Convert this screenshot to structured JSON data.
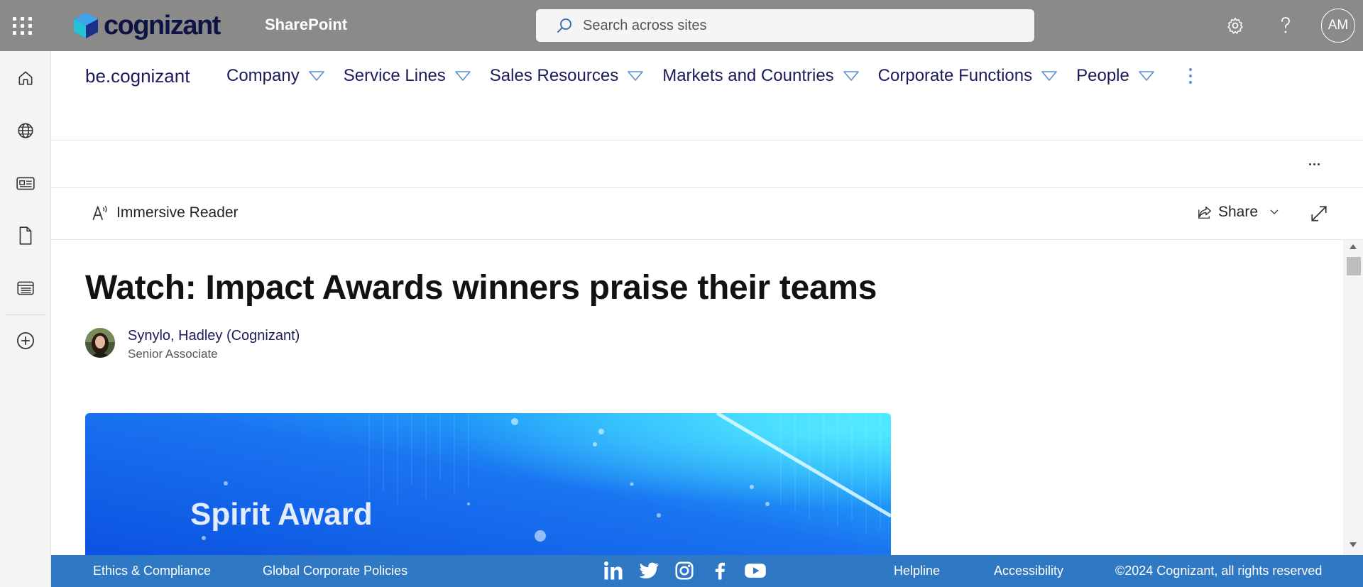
{
  "suitebar": {
    "brand": "cognizant",
    "app_title": "SharePoint",
    "search_placeholder": "Search across sites",
    "user_initials": "AM"
  },
  "site": {
    "name": "be.cognizant",
    "nav": [
      {
        "label": "Company"
      },
      {
        "label": "Service Lines"
      },
      {
        "label": "Sales Resources"
      },
      {
        "label": "Markets and Countries"
      },
      {
        "label": "Corporate Functions"
      },
      {
        "label": "People"
      }
    ]
  },
  "commands": {
    "immersive_reader": "Immersive Reader",
    "share": "Share"
  },
  "article": {
    "title": "Watch: Impact Awards winners praise their teams",
    "author_name": "Synylo, Hadley (Cognizant)",
    "author_role": "Senior Associate",
    "hero_caption": "Spirit Award"
  },
  "footer": {
    "ethics": "Ethics & Compliance",
    "policies": "Global Corporate Policies",
    "helpline": "Helpline",
    "accessibility": "Accessibility",
    "copyright": "©2024 Cognizant, all rights reserved"
  },
  "colors": {
    "suitebar_bg": "#8a8a8a",
    "nav_text": "#1b1b5a",
    "footer_bg": "#2f78c4",
    "hero_blue": "#1a74f0"
  }
}
